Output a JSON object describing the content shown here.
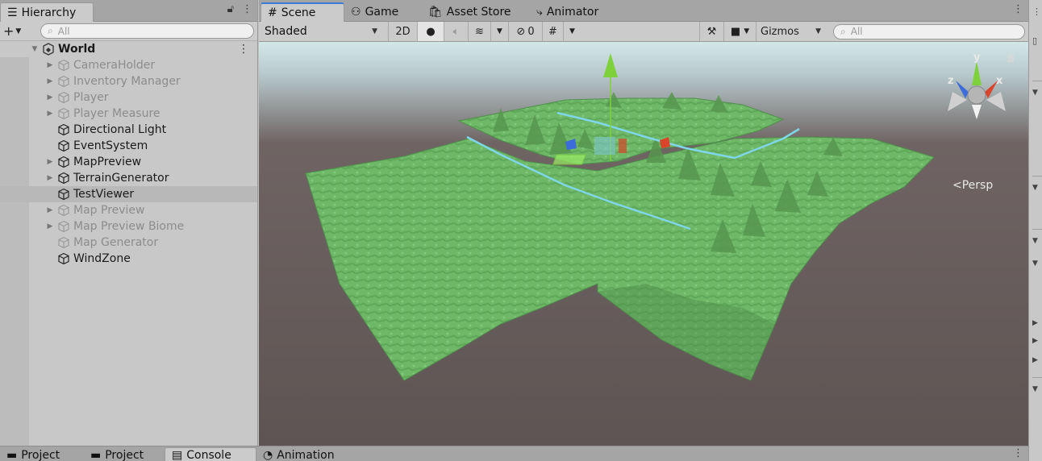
{
  "hierarchy": {
    "tab_label": "Hierarchy",
    "search_placeholder": "All",
    "root": "World",
    "items": [
      {
        "label": "CameraHolder",
        "dim": true,
        "foldable": true
      },
      {
        "label": "Inventory Manager",
        "dim": true,
        "foldable": true
      },
      {
        "label": "Player",
        "dim": true,
        "foldable": true
      },
      {
        "label": "Player Measure",
        "dim": true,
        "foldable": true
      },
      {
        "label": "Directional Light",
        "dim": false,
        "foldable": false
      },
      {
        "label": "EventSystem",
        "dim": false,
        "foldable": false
      },
      {
        "label": "MapPreview",
        "dim": false,
        "foldable": true
      },
      {
        "label": "TerrainGenerator",
        "dim": false,
        "foldable": true
      },
      {
        "label": "TestViewer",
        "dim": false,
        "foldable": false,
        "selected": true
      },
      {
        "label": "Map Preview",
        "dim": true,
        "foldable": true
      },
      {
        "label": "Map Preview Biome",
        "dim": true,
        "foldable": true
      },
      {
        "label": "Map Generator",
        "dim": true,
        "foldable": false
      },
      {
        "label": "WindZone",
        "dim": false,
        "foldable": false
      }
    ]
  },
  "scene_tabs": [
    "Scene",
    "Game",
    "Asset Store",
    "Animator"
  ],
  "scene_toolbar": {
    "shading_mode": "Shaded",
    "mode_2d": "2D",
    "hidden_count": "0",
    "gizmos": "Gizmos",
    "search_placeholder": "All"
  },
  "scene_view": {
    "projection_label": "Persp",
    "gizmo_axes": {
      "y": "y",
      "x": "x",
      "z": "z"
    }
  },
  "bottom_tabs": [
    "Project",
    "Project",
    "Console",
    "Animation"
  ],
  "colors": {
    "terrain_green": "#6fb96a",
    "sky": "#c9dde0",
    "scene_bg": "#5d5453",
    "axis_x": "#d9442b",
    "axis_y": "#7fd13b",
    "axis_z": "#3b6cd9",
    "gizmo_line": "#7fd6e8"
  }
}
